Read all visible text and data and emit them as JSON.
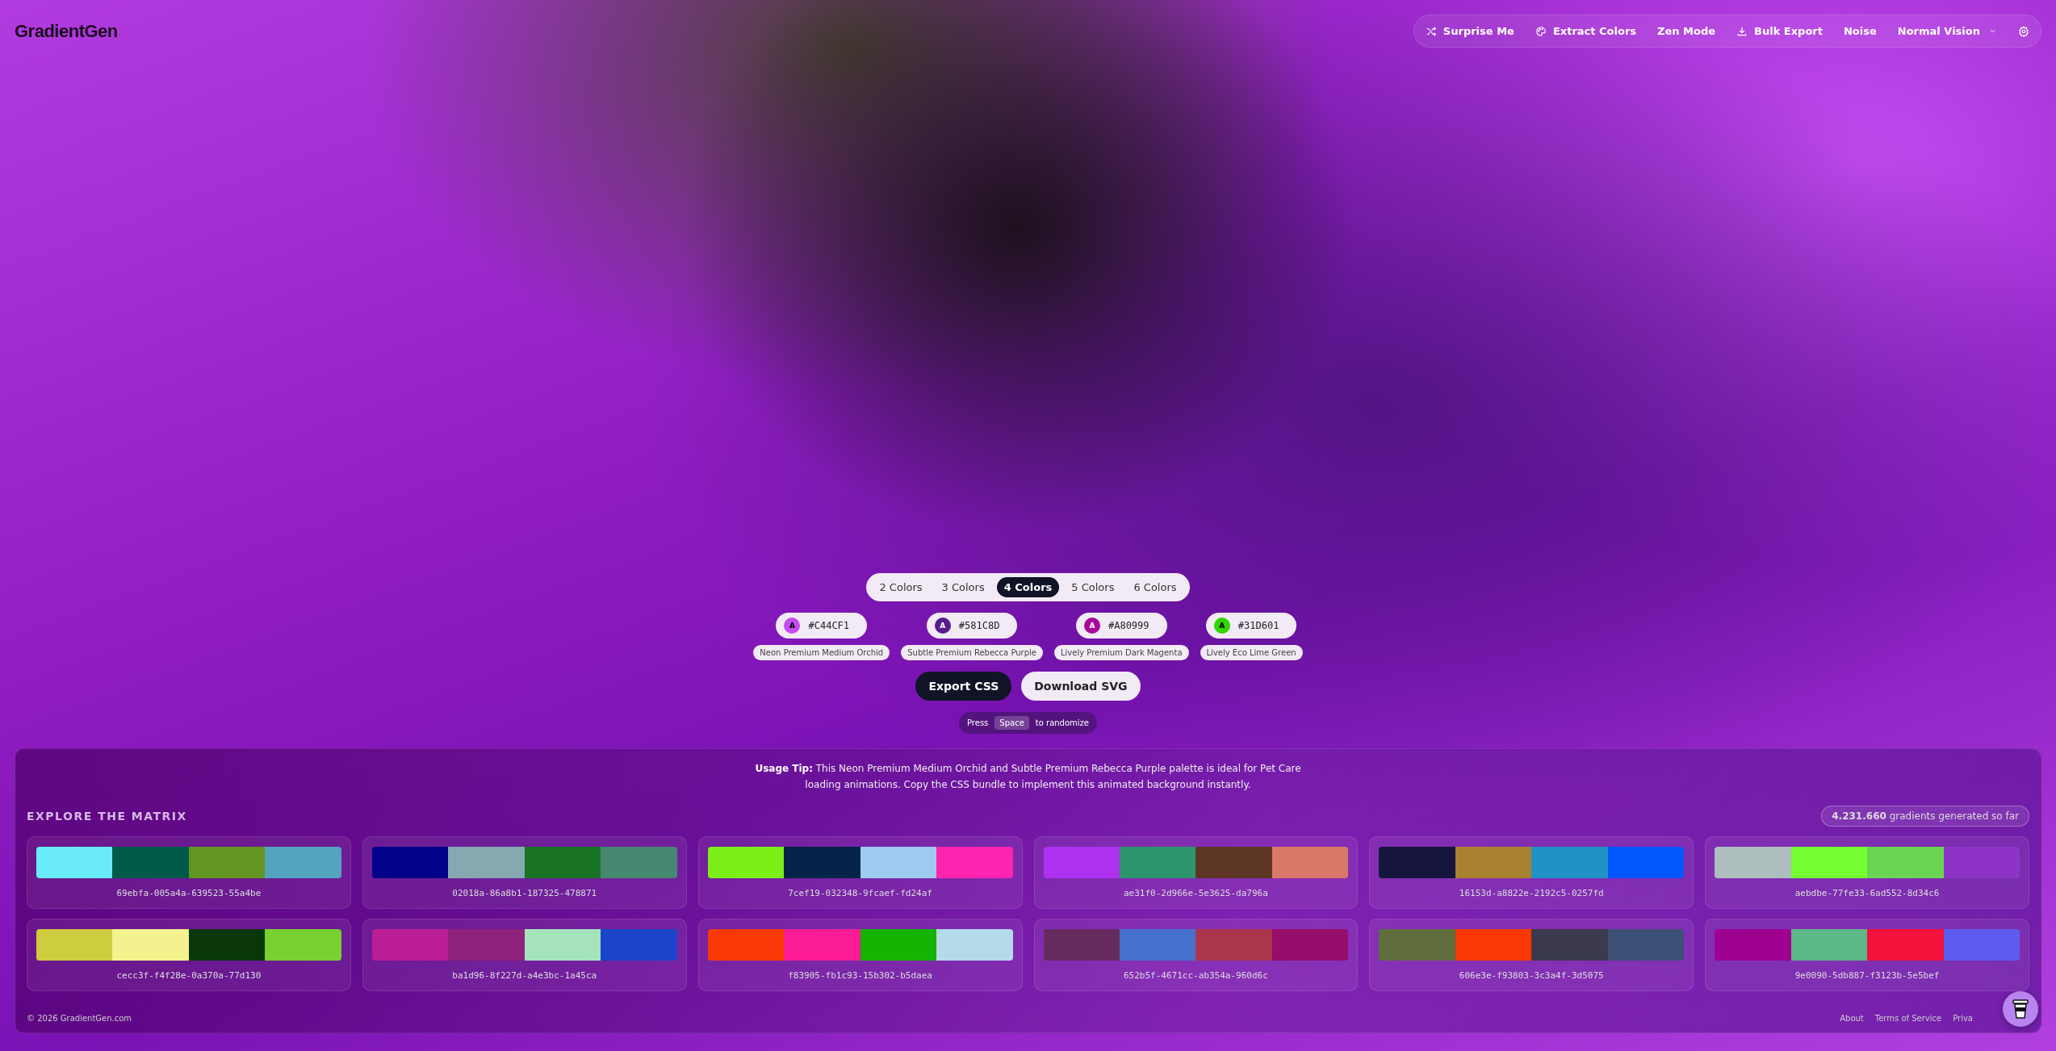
{
  "logo": "GradientGen",
  "nav": [
    {
      "kind": "shuffle",
      "label": "Surprise Me"
    },
    {
      "kind": "palette",
      "label": "Extract Colors"
    },
    {
      "kind": "plain",
      "label": "Zen Mode"
    },
    {
      "kind": "download",
      "label": "Bulk Export"
    },
    {
      "kind": "plain",
      "label": "Noise"
    },
    {
      "kind": "dropdown",
      "label": "Normal Vision"
    },
    {
      "kind": "settings"
    }
  ],
  "color_count_tabs": [
    {
      "label": "2 Colors",
      "selected": false
    },
    {
      "label": "3 Colors",
      "selected": false
    },
    {
      "label": "4 Colors",
      "selected": true
    },
    {
      "label": "5 Colors",
      "selected": false
    },
    {
      "label": "6 Colors",
      "selected": false
    }
  ],
  "colors": [
    {
      "hex": "#C44CF1",
      "contrast_label": "A",
      "color": "#c44cf1",
      "name": "Neon Premium Medium Orchid"
    },
    {
      "hex": "#581C8D",
      "contrast_label": "A",
      "color": "#581c8d",
      "name": "Subtle Premium Rebecca Purple"
    },
    {
      "hex": "#A80999",
      "contrast_label": "A",
      "color": "#a80999",
      "name": "Lively Premium Dark Magenta"
    },
    {
      "hex": "#31D601",
      "contrast_label": "A",
      "color": "#31d601",
      "name": "Lively Eco Lime Green"
    }
  ],
  "actions": [
    {
      "label": "Export CSS",
      "kind": "primary"
    },
    {
      "label": "Download SVG",
      "kind": "secondary"
    }
  ],
  "hint": {
    "before": "Press",
    "key": "Space",
    "after": "to randomize"
  },
  "usage_tip": "**Usage Tip:** This Neon Premium Medium Orchid and Subtle Premium Rebecca Purple palette is ideal for Pet Care loading animations. Copy the CSS bundle to implement this animated background instantly.",
  "matrix": {
    "title": "EXPLORE THE MATRIX",
    "counter": "**4.231.660** gradients generated so far",
    "items": [
      {
        "id": "69ebfa-005a4a-639523-55a4be",
        "swatches": [
          {
            "color": "#69ebfa"
          },
          {
            "color": "#005a4a"
          },
          {
            "color": "#639523"
          },
          {
            "color": "#55a4be"
          }
        ]
      },
      {
        "id": "02018a-86a8b1-187325-478871",
        "swatches": [
          {
            "color": "#02018a"
          },
          {
            "color": "#86a8b1"
          },
          {
            "color": "#187325"
          },
          {
            "color": "#478871"
          }
        ]
      },
      {
        "id": "7cef19-032348-9fcaef-fd24af",
        "swatches": [
          {
            "color": "#7cef19"
          },
          {
            "color": "#032348"
          },
          {
            "color": "#9fcaef"
          },
          {
            "color": "#fd24af"
          }
        ]
      },
      {
        "id": "ae31f0-2d966e-5e3625-da796a",
        "swatches": [
          {
            "color": "#ae31f0"
          },
          {
            "color": "#2d966e"
          },
          {
            "color": "#5e3625"
          },
          {
            "color": "#da796a"
          }
        ]
      },
      {
        "id": "16153d-a8822e-2192c5-0257fd",
        "swatches": [
          {
            "color": "#16153d"
          },
          {
            "color": "#a8822e"
          },
          {
            "color": "#2192c5"
          },
          {
            "color": "#0257fd"
          }
        ]
      },
      {
        "id": "aebdbe-77fe33-6ad552-8d34c6",
        "swatches": [
          {
            "color": "#aebdbe"
          },
          {
            "color": "#77fe33"
          },
          {
            "color": "#6ad552"
          },
          {
            "color": "#8d34c6"
          }
        ]
      },
      {
        "id": "cecc3f-f4f28e-0a370a-77d130",
        "swatches": [
          {
            "color": "#cecc3f"
          },
          {
            "color": "#f4f28e"
          },
          {
            "color": "#0a370a"
          },
          {
            "color": "#77d130"
          }
        ]
      },
      {
        "id": "ba1d96-8f227d-a4e3bc-1a45ca",
        "swatches": [
          {
            "color": "#ba1d96"
          },
          {
            "color": "#8f227d"
          },
          {
            "color": "#a4e3bc"
          },
          {
            "color": "#1a45ca"
          }
        ]
      },
      {
        "id": "f83905-fb1c93-15b302-b5daea",
        "swatches": [
          {
            "color": "#f83905"
          },
          {
            "color": "#fb1c93"
          },
          {
            "color": "#15b302"
          },
          {
            "color": "#b5daea"
          }
        ]
      },
      {
        "id": "652b5f-4671cc-ab354a-960d6c",
        "swatches": [
          {
            "color": "#652b5f"
          },
          {
            "color": "#4671cc"
          },
          {
            "color": "#ab354a"
          },
          {
            "color": "#960d6c"
          }
        ]
      },
      {
        "id": "606e3e-f93803-3c3a4f-3d5075",
        "swatches": [
          {
            "color": "#606e3e"
          },
          {
            "color": "#f93803"
          },
          {
            "color": "#3c3a4f"
          },
          {
            "color": "#3d5075"
          }
        ]
      },
      {
        "id": "9e0090-5db887-f3123b-5e5bef",
        "swatches": [
          {
            "color": "#9e0090"
          },
          {
            "color": "#5db887"
          },
          {
            "color": "#f3123b"
          },
          {
            "color": "#5e5bef"
          }
        ]
      }
    ]
  },
  "footer": {
    "copyright": "© 2026 GradientGen.com",
    "links": [
      "About",
      "Terms of Service",
      "Priva"
    ]
  }
}
